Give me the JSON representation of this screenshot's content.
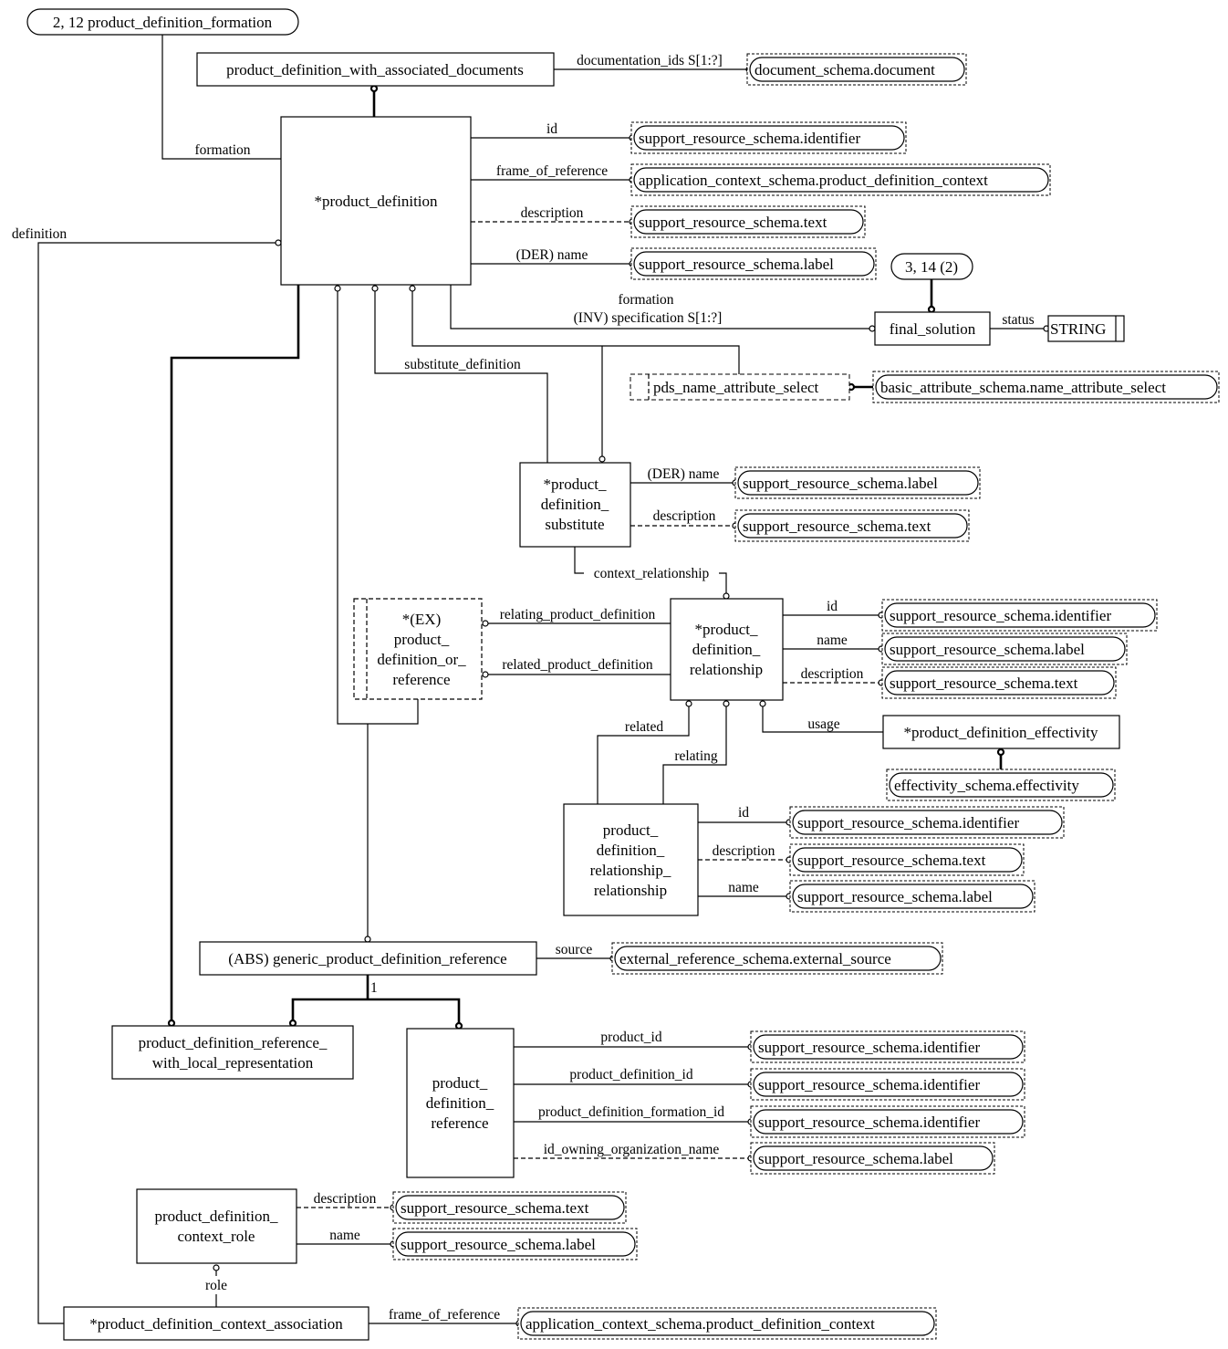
{
  "diagram": {
    "page_refs": {
      "pdf_formation": "2, 12 product_definition_formation",
      "final_solution_ref": "3, 14 (2)"
    },
    "entities": {
      "pd_with_docs": "product_definition_with_associated_documents",
      "product_definition": "*product_definition",
      "final_solution": "final_solution",
      "string_type": "STRING",
      "pds_name_select": "pds_name_attribute_select",
      "pd_substitute": [
        "*product_",
        "definition_",
        "substitute"
      ],
      "pd_or_reference": [
        "*(EX)",
        "product_",
        "definition_or_",
        "reference"
      ],
      "pd_relationship": [
        "*product_",
        "definition_",
        "relationship"
      ],
      "pd_effectivity": "*product_definition_effectivity",
      "pdr_relationship": [
        "product_",
        "definition_",
        "relationship_",
        "relationship"
      ],
      "generic_pdr": "(ABS) generic_product_definition_reference",
      "pdr_with_local": [
        "product_definition_reference_",
        "with_local_representation"
      ],
      "pd_reference": [
        "product_",
        "definition_",
        "reference"
      ],
      "pd_context_role": [
        "product_definition_",
        "context_role"
      ],
      "pd_context_association": "*product_definition_context_association"
    },
    "external_types": {
      "document": "document_schema.document",
      "identifier": "support_resource_schema.identifier",
      "pd_context": "application_context_schema.product_definition_context",
      "text": "support_resource_schema.text",
      "label": "support_resource_schema.label",
      "name_attr_select": "basic_attribute_schema.name_attribute_select",
      "effectivity": "effectivity_schema.effectivity",
      "external_source": "external_reference_schema.external_source"
    },
    "relations": {
      "documentation_ids": "documentation_ids S[1:?]",
      "formation": "formation",
      "definition": "definition",
      "id": "id",
      "frame_of_reference": "frame_of_reference",
      "description": "description",
      "der_name": "(DER) name",
      "inv_formation": "formation",
      "inv_specification": "(INV) specification S[1:?]",
      "status": "status",
      "substitute_definition": "substitute_definition",
      "context_relationship": "context_relationship",
      "relating_pd": "relating_product_definition",
      "related_pd": "related_product_definition",
      "name": "name",
      "usage": "usage",
      "related": "related",
      "relating": "relating",
      "source": "source",
      "cardinality_one": "1",
      "product_id": "product_id",
      "product_definition_id": "product_definition_id",
      "product_definition_formation_id": "product_definition_formation_id",
      "id_owning_organization_name": "id_owning_organization_name",
      "role": "role"
    }
  }
}
